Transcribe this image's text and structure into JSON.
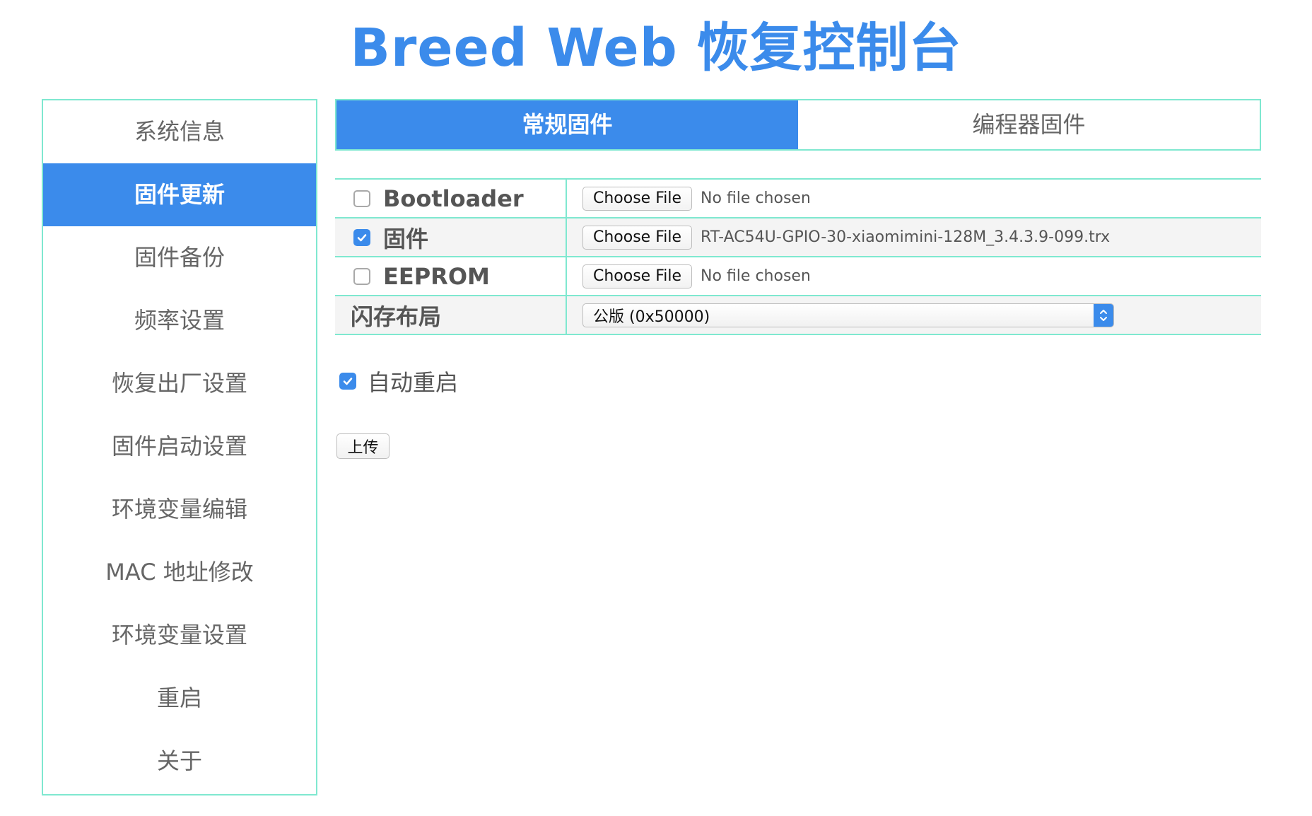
{
  "app": {
    "title": "Breed Web 恢复控制台"
  },
  "sidebar": {
    "items": [
      {
        "label": "系统信息"
      },
      {
        "label": "固件更新",
        "active": true
      },
      {
        "label": "固件备份"
      },
      {
        "label": "频率设置"
      },
      {
        "label": "恢复出厂设置"
      },
      {
        "label": "固件启动设置"
      },
      {
        "label": "环境变量编辑"
      },
      {
        "label": "MAC 地址修改"
      },
      {
        "label": "环境变量设置"
      },
      {
        "label": "重启"
      },
      {
        "label": "关于"
      }
    ]
  },
  "tabs": [
    {
      "label": "常规固件",
      "active": true
    },
    {
      "label": "编程器固件"
    }
  ],
  "firmware": {
    "rows": [
      {
        "label": "Bootloader",
        "checked": false,
        "button": "Choose File",
        "file": "No file chosen"
      },
      {
        "label": "固件",
        "checked": true,
        "button": "Choose File",
        "file": "RT-AC54U-GPIO-30-xiaomimini-128M_3.4.3.9-099.trx"
      },
      {
        "label": "EEPROM",
        "checked": false,
        "button": "Choose File",
        "file": "No file chosen"
      }
    ],
    "flash_layout": {
      "label": "闪存布局",
      "selected": "公版 (0x50000)"
    }
  },
  "options": {
    "auto_reboot": {
      "label": "自动重启",
      "checked": true
    }
  },
  "actions": {
    "upload_label": "上传"
  },
  "colors": {
    "accent": "#3b8beb",
    "border": "#7fe8d0"
  }
}
